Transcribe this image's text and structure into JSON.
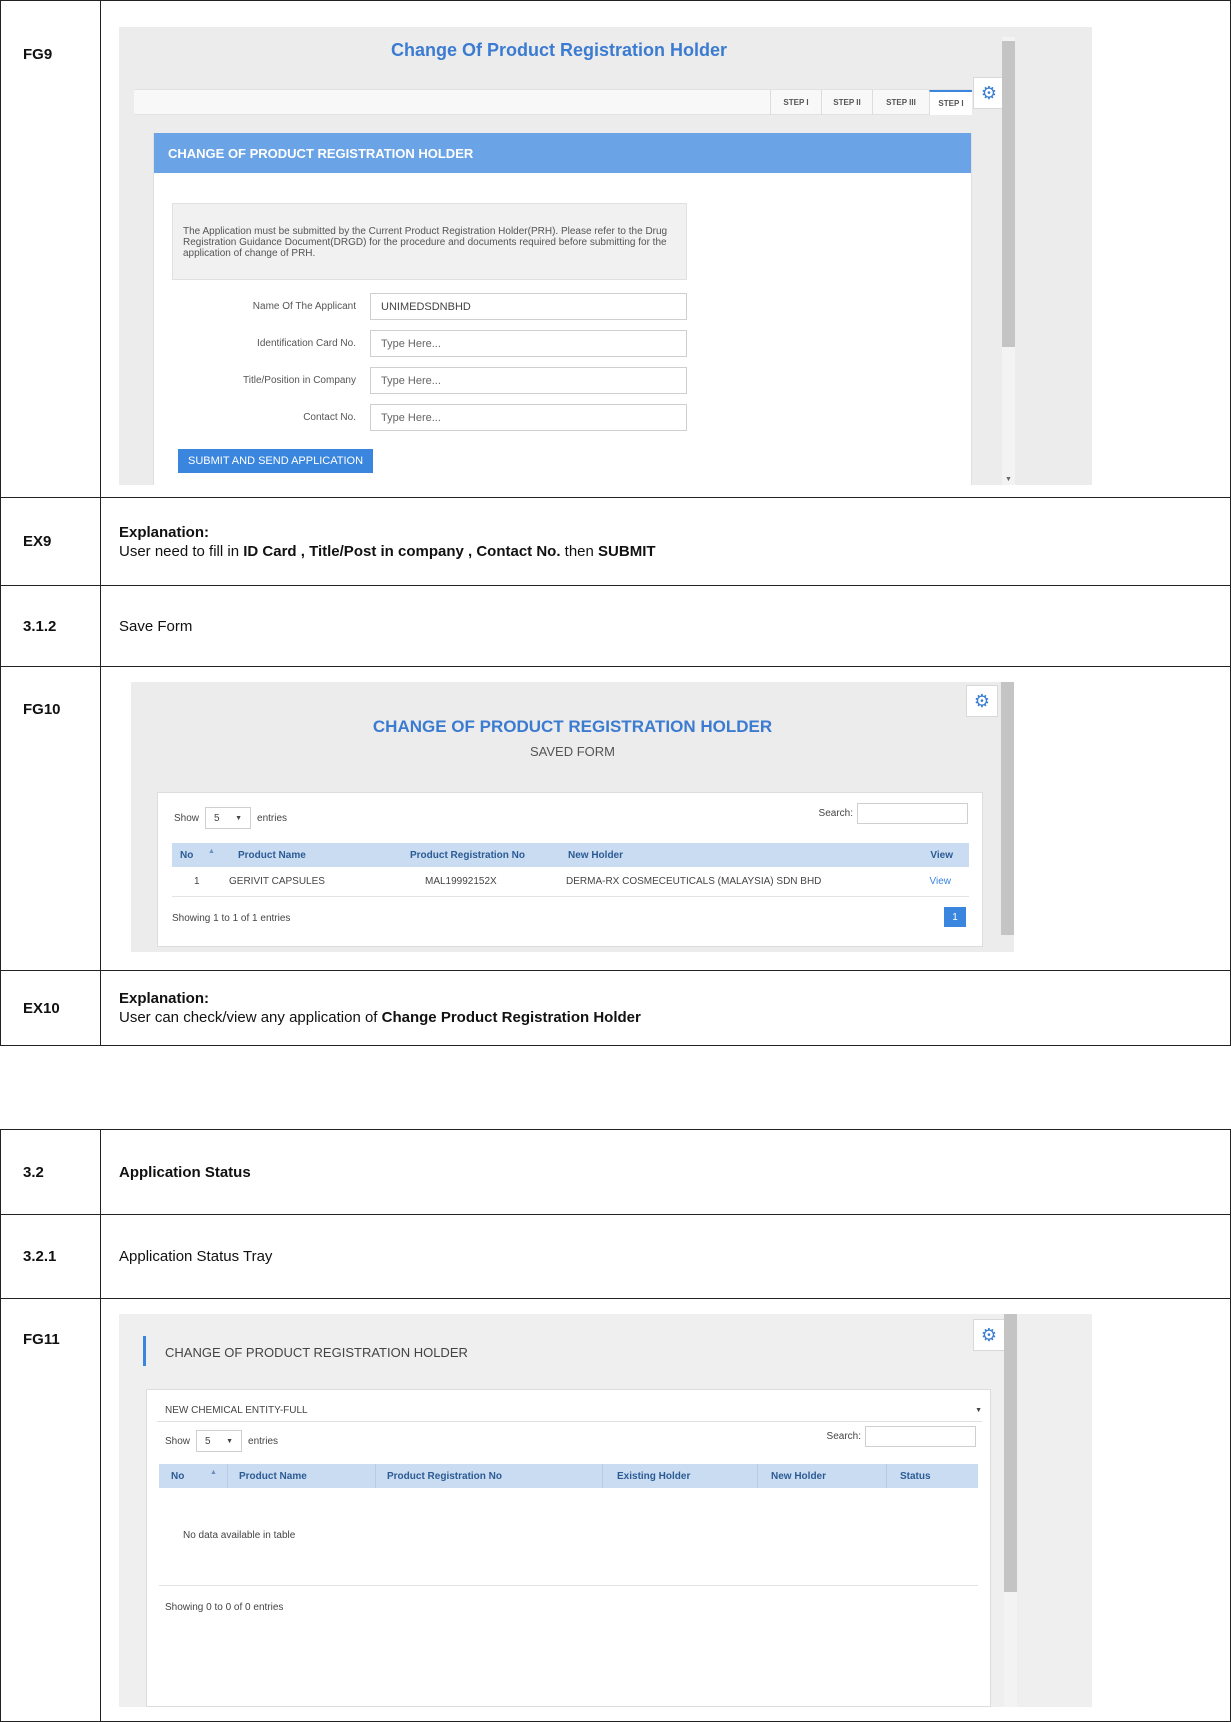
{
  "fg9": {
    "label": "FG9",
    "title": "Change Of Product Registration Holder",
    "steps": [
      "STEP I",
      "STEP II",
      "STEP III",
      "STEP I"
    ],
    "panel_title": "CHANGE OF PRODUCT REGISTRATION HOLDER",
    "notice": "The Application must be submitted by the Current Product Registration Holder(PRH). Please refer to the Drug Registration Guidance Document(DRGD) for the procedure and documents required before submitting for the application of change of PRH.",
    "fields": [
      {
        "label": "Name Of The Applicant",
        "value": "UNIMEDSDNBHD"
      },
      {
        "label": "Identification Card No.",
        "value": "Type Here..."
      },
      {
        "label": "Title/Position in Company",
        "value": "Type Here..."
      },
      {
        "label": "Contact No.",
        "value": "Type Here..."
      }
    ],
    "submit_label": "SUBMIT AND SEND APPLICATION"
  },
  "ex9": {
    "label": "EX9",
    "heading": "Explanation:",
    "text_1": "User need to fill in ",
    "bold_1": "ID Card , Title/Post in company , Contact No.",
    "text_2": " then ",
    "bold_2": "SUBMIT"
  },
  "s312": {
    "label": "3.1.2",
    "text": "Save Form"
  },
  "fg10": {
    "label": "FG10",
    "title": "CHANGE OF PRODUCT REGISTRATION HOLDER",
    "subtitle": "SAVED FORM",
    "show": "Show",
    "entries_value": "5",
    "entries": "entries",
    "search": "Search:",
    "columns": [
      "No",
      "Product Name",
      "Product Registration No",
      "New Holder",
      "View"
    ],
    "row": {
      "no": "1",
      "name": "GERIVIT CAPSULES",
      "reg": "MAL19992152X",
      "holder": "DERMA-RX COSMECEUTICALS (MALAYSIA) SDN BHD",
      "view": "View"
    },
    "showing": "Showing 1 to 1 of 1 entries",
    "page": "1"
  },
  "ex10": {
    "label": "EX10",
    "heading": "Explanation:",
    "text_1": "User can check/view any application of ",
    "bold_1": "Change Product Registration Holder"
  },
  "s32": {
    "label": "3.2",
    "text": "Application Status"
  },
  "s321": {
    "label": "3.2.1",
    "text": "Application Status Tray"
  },
  "fg11": {
    "label": "FG11",
    "title": "CHANGE OF PRODUCT REGISTRATION HOLDER",
    "dropdown": "NEW CHEMICAL ENTITY-FULL",
    "show": "Show",
    "entries_value": "5",
    "entries": "entries",
    "search": "Search:",
    "columns": [
      "No",
      "Product Name",
      "Product Registration No",
      "Existing Holder",
      "New Holder",
      "Status"
    ],
    "empty": "No data available in table",
    "showing": "Showing 0 to 0 of 0 entries"
  }
}
